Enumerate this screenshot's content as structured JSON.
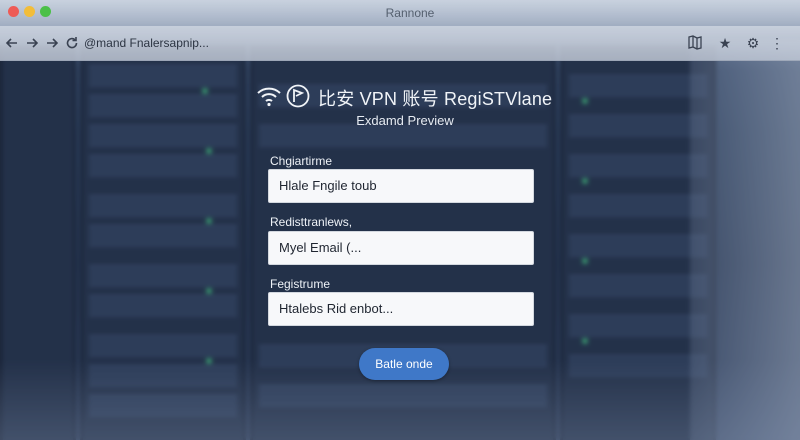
{
  "browser": {
    "tab_title": "Rannone",
    "url": "@mand Fnalersapnip...",
    "back_icon": "arrow-left-icon",
    "forward_icon": "arrow-right-icon",
    "reload_icon": "reload-icon",
    "tools": [
      "map-icon",
      "star-icon",
      "gear-icon",
      "more-vertical-icon"
    ]
  },
  "header": {
    "title": "比安 VPN 账号 RegiSTVlane",
    "subtitle": "Exdamd Preview",
    "icons": [
      "wifi-icon",
      "flag-icon"
    ]
  },
  "form": {
    "fields": [
      {
        "label": "Chgiartirme",
        "value": "Hlale Fngile toub"
      },
      {
        "label": "Redisttranlews,",
        "value": "Myel Email (..."
      },
      {
        "label": "Fegistrume",
        "value": "Htalebs Rid enbot..."
      }
    ],
    "submit_label": "Batle onde"
  },
  "colors": {
    "accent": "#3f78c8",
    "field_bg": "#f7f8fa",
    "text_light": "#f1f4f8"
  }
}
